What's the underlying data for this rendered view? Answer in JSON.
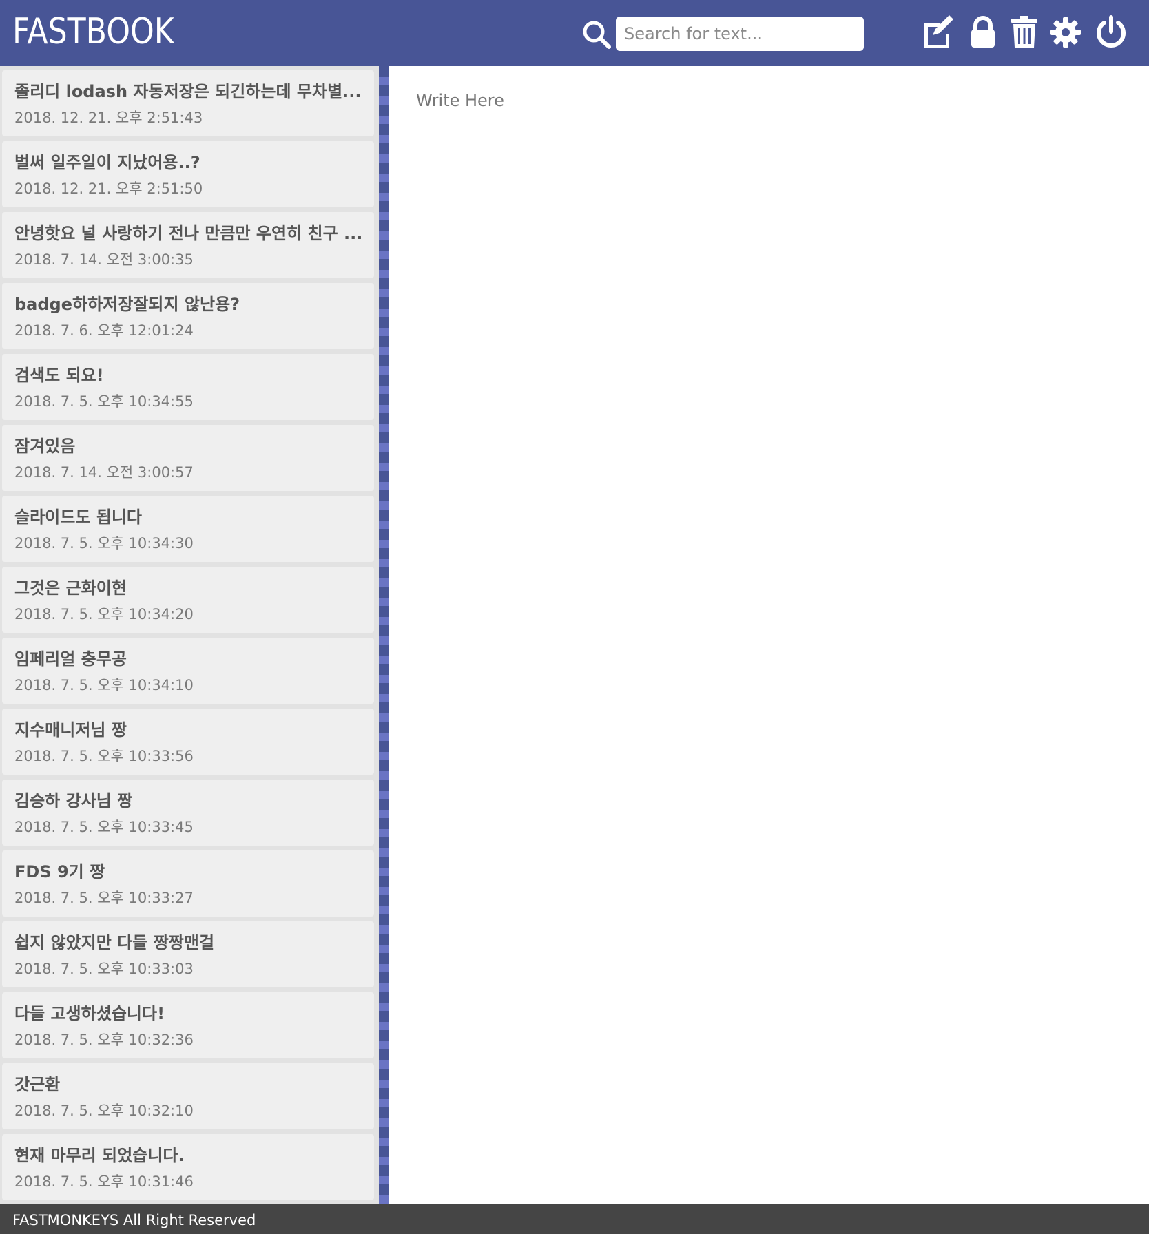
{
  "header": {
    "logo": "FASTBOOK",
    "search": {
      "placeholder": "Search for text...",
      "value": ""
    },
    "icons": [
      "edit-icon",
      "lock-icon",
      "trash-icon",
      "gear-icon",
      "power-icon"
    ]
  },
  "notes": [
    {
      "title": "졸리디 lodash 자동저장은 되긴하는데 무차별...",
      "date": "2018. 12. 21. 오후 2:51:43"
    },
    {
      "title": "벌써 일주일이 지났어용..?",
      "date": "2018. 12. 21. 오후 2:51:50"
    },
    {
      "title": "안녕핫요 널 사랑하기 전나 만큼만 우연히 친구 ...",
      "date": "2018. 7. 14. 오전 3:00:35"
    },
    {
      "title": "badge하하저장잘되지 않난용?",
      "date": "2018. 7. 6. 오후 12:01:24"
    },
    {
      "title": "검색도 되요!",
      "date": "2018. 7. 5. 오후 10:34:55"
    },
    {
      "title": "잠겨있음",
      "date": "2018. 7. 14. 오전 3:00:57"
    },
    {
      "title": "슬라이드도 됩니다",
      "date": "2018. 7. 5. 오후 10:34:30"
    },
    {
      "title": "그것은 근화이현",
      "date": "2018. 7. 5. 오후 10:34:20"
    },
    {
      "title": "임페리얼 충무공",
      "date": "2018. 7. 5. 오후 10:34:10"
    },
    {
      "title": "지수매니저님 짱",
      "date": "2018. 7. 5. 오후 10:33:56"
    },
    {
      "title": "김승하 강사님 짱",
      "date": "2018. 7. 5. 오후 10:33:45"
    },
    {
      "title": "FDS 9기 짱",
      "date": "2018. 7. 5. 오후 10:33:27"
    },
    {
      "title": "쉽지 않았지만 다들 짱짱맨걸",
      "date": "2018. 7. 5. 오후 10:33:03"
    },
    {
      "title": "다들 고생하셨습니다!",
      "date": "2018. 7. 5. 오후 10:32:36"
    },
    {
      "title": "갓근환",
      "date": "2018. 7. 5. 오후 10:32:10"
    },
    {
      "title": "현재 마무리 되었습니다.",
      "date": "2018. 7. 5. 오후 10:31:46"
    }
  ],
  "editor": {
    "text": "Write Here"
  },
  "footer": {
    "text": "FASTMONKEYS All Right Reserved"
  },
  "colors": {
    "header": "#485596",
    "footer": "#454545",
    "note_bg": "#efefef",
    "divider_light": "#6a74c4"
  }
}
